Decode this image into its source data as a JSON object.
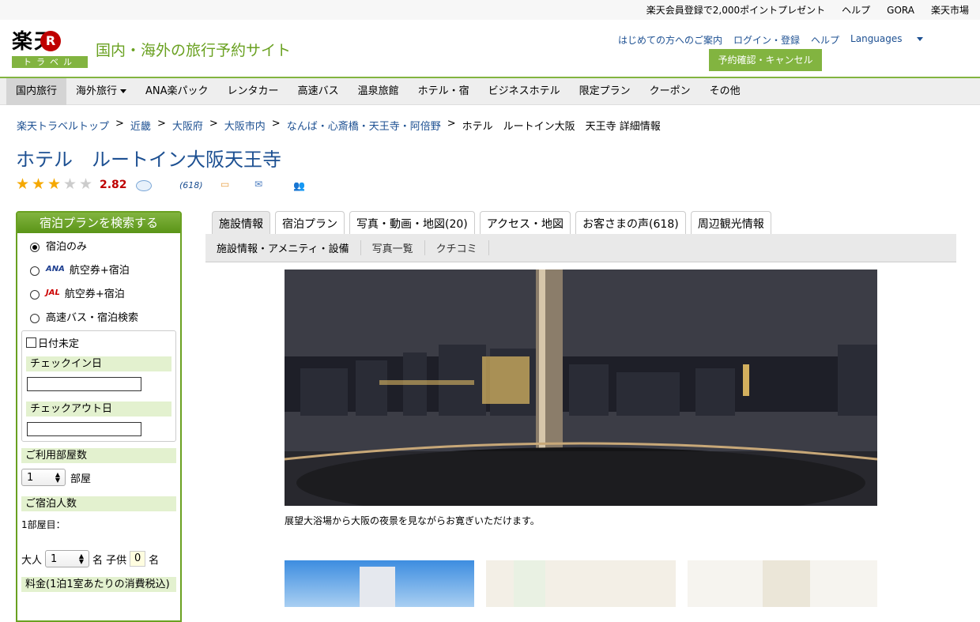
{
  "topbar": {
    "items": [
      "楽天会員登録で2,000ポイントプレゼント",
      "ヘルプ",
      "GORA",
      "楽天市場"
    ]
  },
  "header": {
    "logo_kanji": "楽天",
    "logo_r": "R",
    "logo_travel": "トラベル",
    "site_title": "国内・海外の旅行予約サイト",
    "links": [
      "はじめての方へのご案内",
      "ログイン・登録",
      "ヘルプ"
    ],
    "languages": "Languages",
    "mypage_button": "予約確認・キャンセル"
  },
  "nav": {
    "items": [
      "国内旅行",
      "海外旅行",
      "ANA楽パック",
      "レンタカー",
      "高速バス",
      "温泉旅館",
      "ホテル・宿",
      "ビジネスホテル",
      "限定プラン",
      "クーポン",
      "その他"
    ]
  },
  "breadcrumb": {
    "items": [
      "楽天トラベルトップ",
      "近畿",
      "大阪府",
      "大阪市内",
      "なんば・心斎橋・天王寺・阿倍野"
    ],
    "current": "ホテル　ルートイン大阪　天王寺 詳細情報"
  },
  "hotel": {
    "title": "ホテル　ルートイン大阪天王寺",
    "rating": 2.82,
    "rating_text": "2.82",
    "review_count": "(618)",
    "stars_filled": 3,
    "stars_total": 5
  },
  "sidebar": {
    "title": "宿泊プランを検索する",
    "options": [
      {
        "airline": "",
        "label": "宿泊のみ",
        "selected": true
      },
      {
        "airline": "ANA",
        "label": "航空券+宿泊",
        "selected": false
      },
      {
        "airline": "JAL",
        "label": "航空券+宿泊",
        "selected": false
      },
      {
        "airline": "",
        "label": "高速バス・宿泊検索",
        "selected": false
      }
    ],
    "date_undecided": "日付未定",
    "checkin_label": "チェックイン日",
    "checkout_label": "チェックアウト日",
    "rooms_label": "ご利用部屋数",
    "rooms_value": "1",
    "rooms_unit": "部屋",
    "guests_label": "ご宿泊人数",
    "room_line": "1部屋目：",
    "adults_label": "大人",
    "adults_value": "1",
    "children_label": "名 子供",
    "children_value": "0",
    "children_unit": "名",
    "more_label": "料金(1泊1室あたりの消費税込)"
  },
  "tabs": {
    "items": [
      "施設情報",
      "宿泊プラン",
      "写真・動画・地図(20)",
      "アクセス・地図",
      "お客さまの声(618)",
      "周辺観光情報"
    ]
  },
  "subnav": {
    "items": [
      "施設情報・アメニティ・設備",
      "写真一覧",
      "クチコミ"
    ]
  },
  "photo": {
    "caption": "展望大浴場から大阪の夜景を見ながらお寛ぎいただけます。"
  }
}
